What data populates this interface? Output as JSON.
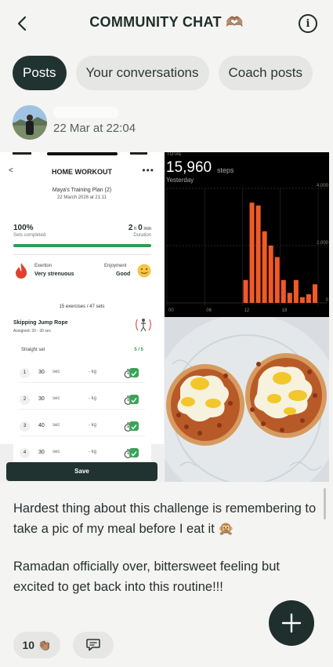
{
  "header": {
    "title": "COMMUNITY CHAT 🫶🏽",
    "back_icon": "chevron-left-icon",
    "info_icon": "info-icon"
  },
  "tabs": [
    {
      "label": "Posts",
      "active": true
    },
    {
      "label": "Your conversations",
      "active": false
    },
    {
      "label": "Coach posts",
      "active": false
    }
  ],
  "post": {
    "timestamp": "22 Mar at 22:04",
    "workout_screenshot": {
      "title": "HOME WORKOUT",
      "plan": "Maya's Training Plan (2)",
      "date": "22 March 2026 at 21:11",
      "sets_pct": "100%",
      "sets_label": "Sets completed",
      "duration_h": "2",
      "duration_m": "0",
      "duration_label": "Duration",
      "progress": 1.0,
      "exertion_label": "Exertion",
      "exertion_value": "Very strenuous",
      "enjoyment_label": "Enjoyment",
      "enjoyment_value": "Good",
      "exercise_count": "15 exercises / 47 sets",
      "exercise_name": "Skipping Jump Rope",
      "assigned": "Assigned: 20 - 30 sec",
      "set_type": "Straight set",
      "set_progress": "5 / 5",
      "rows": [
        {
          "num": "1",
          "value": "30",
          "unit": "sec",
          "kg": "- kg"
        },
        {
          "num": "2",
          "value": "30",
          "unit": "sec",
          "kg": "- kg"
        },
        {
          "num": "3",
          "value": "40",
          "unit": "sec",
          "kg": "- kg"
        },
        {
          "num": "4",
          "value": "30",
          "unit": "sec",
          "kg": "- kg"
        }
      ],
      "save_label": "Save"
    },
    "steps_screenshot": {
      "total_label": "TOTAL",
      "value": "15,960",
      "unit": "steps",
      "period": "Yesterday",
      "y_ticks": [
        "4,000",
        "2,000",
        "0"
      ],
      "x_ticks": [
        "00",
        "06",
        "12",
        "18"
      ],
      "bar_color": "#ef5a28",
      "hours": [
        12,
        13,
        14,
        15,
        16,
        17,
        18,
        19,
        20,
        21,
        22,
        23
      ],
      "bars": [
        800,
        3500,
        3400,
        2500,
        2000,
        1600,
        800,
        350,
        800,
        200,
        300,
        650
      ]
    },
    "caption_p1": "Hardest thing about this challenge is remembering to take a pic of my meal before I eat it 🙊",
    "caption_p2": "Ramadan officially over, bittersweet feeling but excited to get back into this routine!!!",
    "clap_count": "10",
    "clap_icon": "👏🏽"
  },
  "colors": {
    "accent": "#213330",
    "tab_inactive": "#e6e6e4",
    "background": "#f4f4f2"
  }
}
